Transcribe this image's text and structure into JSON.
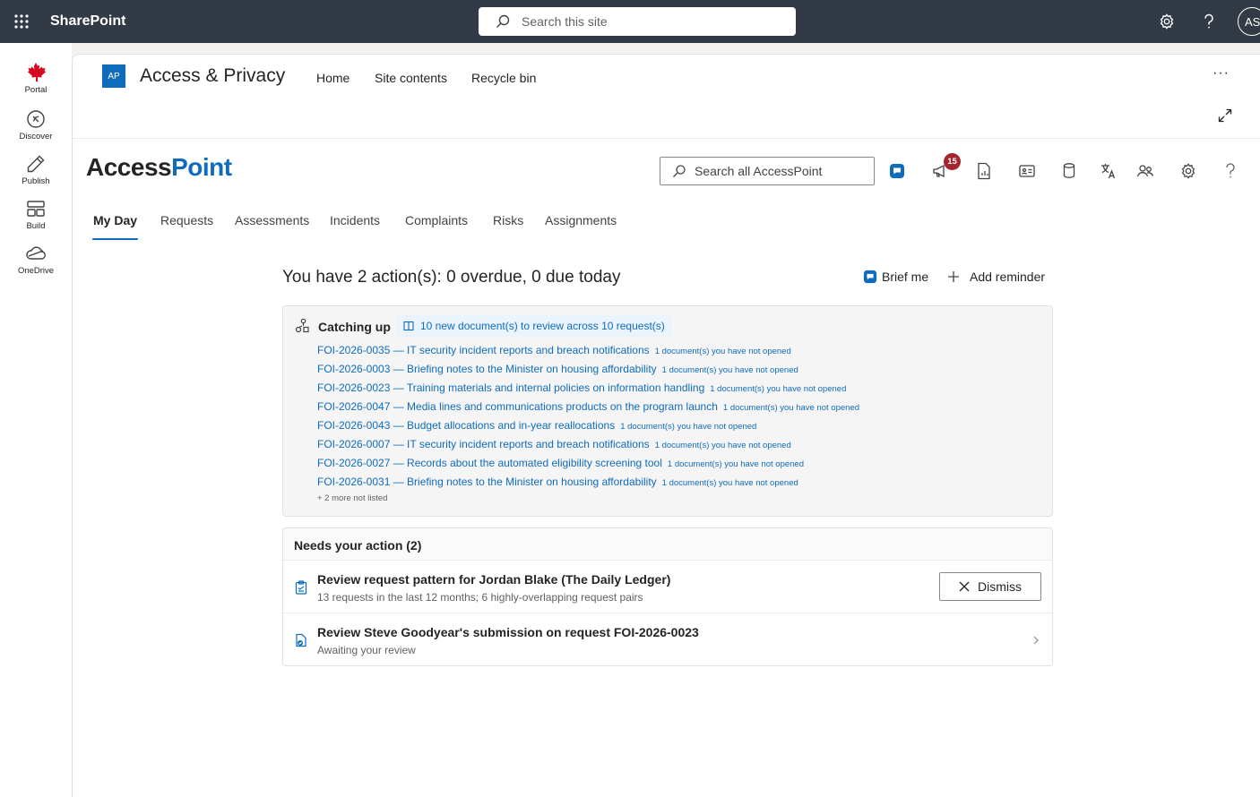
{
  "suite": {
    "brand": "SharePoint",
    "search_placeholder": "Search this site",
    "avatar_initials": "AS"
  },
  "appbar": {
    "items": [
      {
        "label": "Portal",
        "icon": "maple-leaf-icon"
      },
      {
        "label": "Discover",
        "icon": "compass-icon"
      },
      {
        "label": "Publish",
        "icon": "pen-icon"
      },
      {
        "label": "Build",
        "icon": "grid-icon"
      },
      {
        "label": "OneDrive",
        "icon": "cloud-icon"
      }
    ]
  },
  "site": {
    "logo_initials": "AP",
    "title": "Access & Privacy",
    "nav": [
      "Home",
      "Site contents",
      "Recycle bin"
    ],
    "more": "···"
  },
  "app": {
    "logo_part1": "Access",
    "logo_part2": "Point",
    "search_placeholder": "Search all AccessPoint",
    "notification_count": "15",
    "toolbar_icons": [
      "copilot-chat-icon",
      "megaphone-icon",
      "report-icon",
      "contact-card-icon",
      "database-icon",
      "translate-icon",
      "people-icon",
      "settings-icon",
      "help-icon"
    ],
    "tabs": [
      "My Day",
      "Requests",
      "Assessments",
      "Incidents",
      "Complaints",
      "Risks",
      "Assignments"
    ],
    "active_tab": "My Day",
    "brand_color": "#0f6cbd"
  },
  "myday": {
    "summary": "You have 2 action(s): 0 overdue, 0 due today",
    "brief_me": "Brief me",
    "add_reminder": "Add reminder",
    "catching_up": {
      "title": "Catching up",
      "pill": "10 new document(s) to review across 10 request(s)",
      "items": [
        {
          "link": "FOI-2026-0035 — IT security incident reports and breach notifications",
          "note": "1 document(s) you have not opened"
        },
        {
          "link": "FOI-2026-0003 — Briefing notes to the Minister on housing affordability",
          "note": "1 document(s) you have not opened"
        },
        {
          "link": "FOI-2026-0023 — Training materials and internal policies on information handling",
          "note": "1 document(s) you have not opened"
        },
        {
          "link": "FOI-2026-0047 — Media lines and communications products on the program launch",
          "note": "1 document(s) you have not opened"
        },
        {
          "link": "FOI-2026-0043 — Budget allocations and in-year reallocations",
          "note": "1 document(s) you have not opened"
        },
        {
          "link": "FOI-2026-0007 — IT security incident reports and breach notifications",
          "note": "1 document(s) you have not opened"
        },
        {
          "link": "FOI-2026-0027 — Records about the automated eligibility screening tool",
          "note": "1 document(s) you have not opened"
        },
        {
          "link": "FOI-2026-0031 — Briefing notes to the Minister on housing affordability",
          "note": "1 document(s) you have not opened"
        }
      ],
      "more_text": "+ 2 more not listed"
    },
    "needs_action": {
      "title": "Needs your action (2)",
      "items": [
        {
          "title": "Review request pattern for Jordan Blake (The Daily Ledger)",
          "subtitle": "13 requests in the last 12 months; 6 highly-overlapping request pairs",
          "action": "Dismiss"
        },
        {
          "title": "Review Steve Goodyear's submission on request FOI-2026-0023",
          "subtitle": "Awaiting your review"
        }
      ]
    }
  }
}
